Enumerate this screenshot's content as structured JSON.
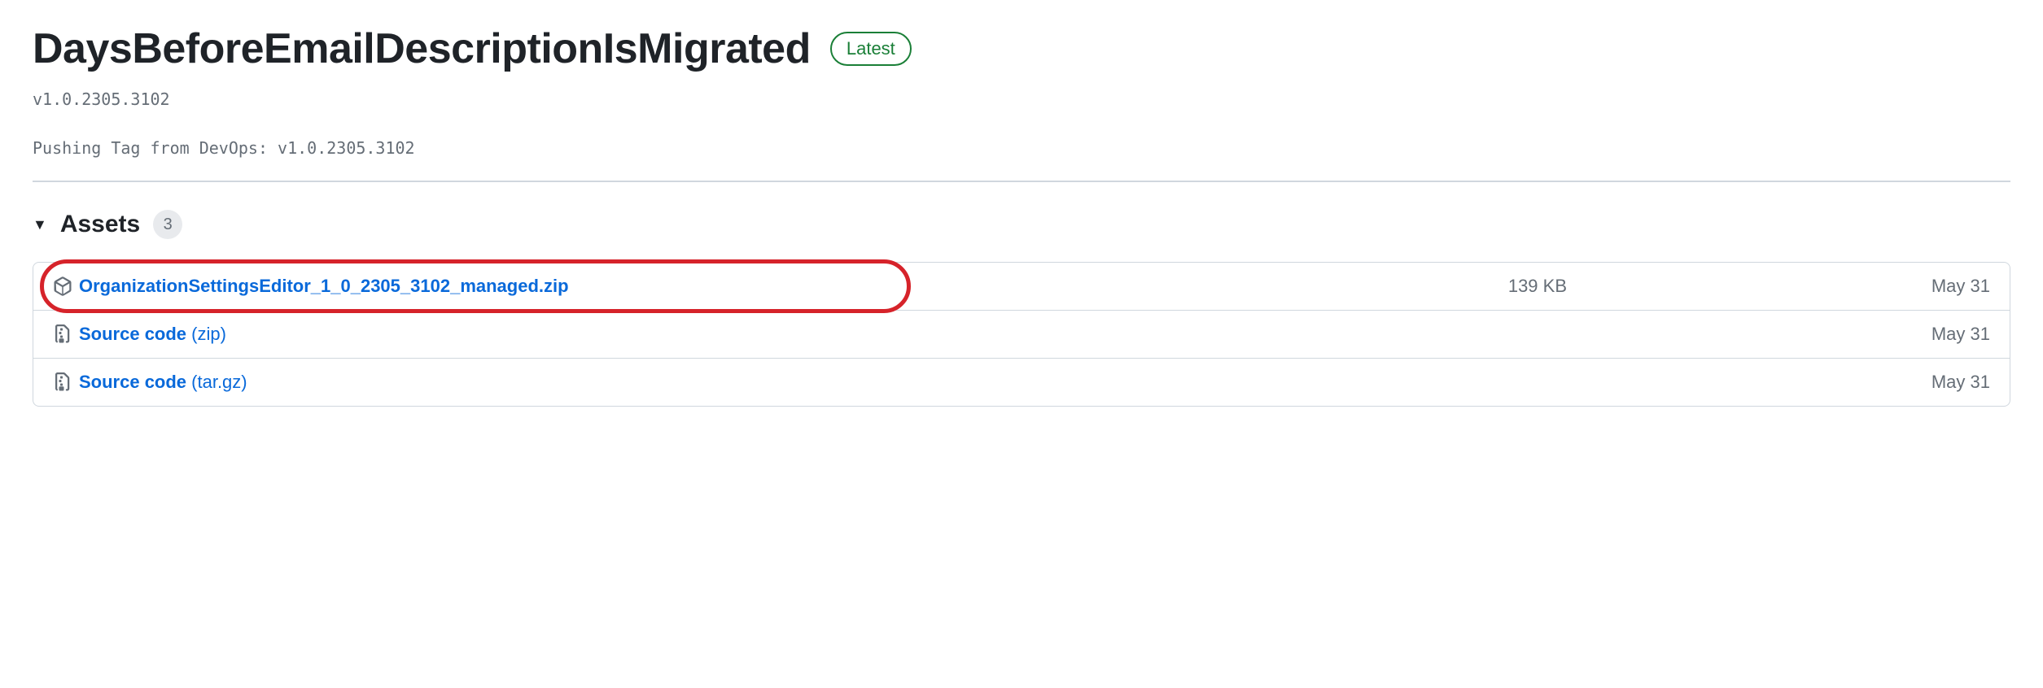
{
  "release": {
    "title": "DaysBeforeEmailDescriptionIsMigrated",
    "badge": "Latest",
    "version": "v1.0.2305.3102",
    "description": "Pushing Tag from DevOps: v1.0.2305.3102"
  },
  "assets": {
    "heading": "Assets",
    "count": "3",
    "items": [
      {
        "icon": "package",
        "name": "OrganizationSettingsEditor_1_0_2305_3102_managed.zip",
        "suffix": "",
        "size": "139 KB",
        "date": "May 31",
        "highlighted": true
      },
      {
        "icon": "zip",
        "name": "Source code",
        "suffix": " (zip)",
        "size": "",
        "date": "May 31",
        "highlighted": false
      },
      {
        "icon": "zip",
        "name": "Source code",
        "suffix": " (tar.gz)",
        "size": "",
        "date": "May 31",
        "highlighted": false
      }
    ]
  }
}
